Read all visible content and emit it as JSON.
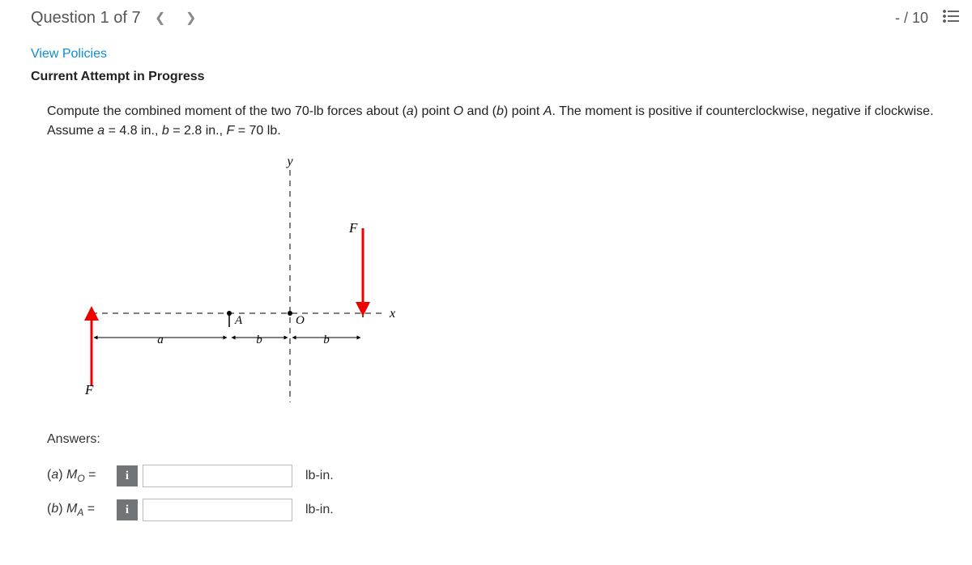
{
  "header": {
    "question_label": "Question 1 of 7",
    "score_label": "- / 10"
  },
  "links": {
    "view_policies": "View Policies"
  },
  "attempt_label": "Current Attempt in Progress",
  "problem": {
    "line1_a": "Compute the combined moment of the two 70-lb forces about (",
    "line1_b": ") point ",
    "line1_c": " and (",
    "line1_d": ") point ",
    "line1_e": ". The moment is positive if counterclockwise, negative if clockwise.",
    "a_letter": "a",
    "b_letter": "b",
    "O": "O",
    "A": "A",
    "line2_a": "Assume ",
    "line2_b": " = 4.8 in., ",
    "line2_c": " = 2.8 in., ",
    "line2_d": " = 70 lb.",
    "var_a": "a",
    "var_b": "b",
    "var_F": "F"
  },
  "figure": {
    "y": "y",
    "x": "x",
    "F": "F",
    "O": "O",
    "A": "A",
    "a": "a",
    "b": "b"
  },
  "answers": {
    "heading": "Answers:",
    "rowA": {
      "prefix": "(",
      "letter": "a",
      "mid": ") ",
      "sym": "M",
      "sub": "O",
      "eq": " =",
      "info": "i",
      "unit": "lb-in."
    },
    "rowB": {
      "prefix": "(",
      "letter": "b",
      "mid": ") ",
      "sym": "M",
      "sub": "A",
      "eq": " =",
      "info": "i",
      "unit": "lb-in."
    }
  }
}
